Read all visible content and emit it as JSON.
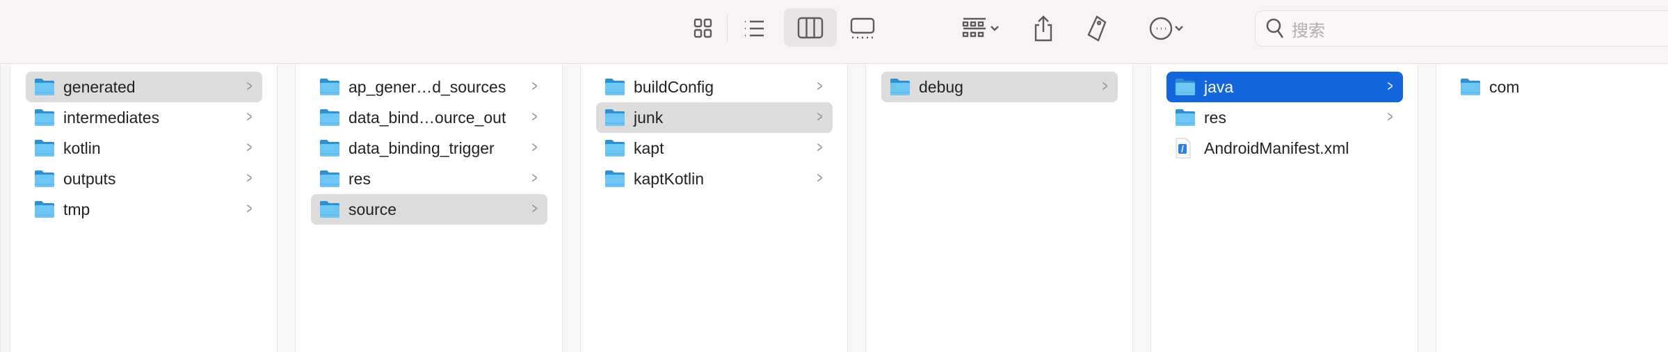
{
  "toolbar": {
    "view_buttons": [
      {
        "icon": "icon-view-icon"
      },
      {
        "icon": "list-view-icon"
      },
      {
        "icon": "column-view-icon",
        "selected": true
      },
      {
        "icon": "gallery-view-icon"
      }
    ],
    "group_icon": "group-icon",
    "share_icon": "share-icon",
    "tag_icon": "tag-icon",
    "more_icon": "more-icon",
    "search_placeholder": "搜索"
  },
  "colors": {
    "selection_active": "#1366de",
    "selection_inactive": "#dcdcdc",
    "folder": "#5ab8f0"
  },
  "columns": [
    {
      "items": [
        {
          "label": "generated",
          "type": "folder",
          "state": "highlighted"
        },
        {
          "label": "intermediates",
          "type": "folder"
        },
        {
          "label": "kotlin",
          "type": "folder"
        },
        {
          "label": "outputs",
          "type": "folder"
        },
        {
          "label": "tmp",
          "type": "folder"
        }
      ]
    },
    {
      "items": [
        {
          "label": "ap_gener…d_sources",
          "type": "folder"
        },
        {
          "label": "data_bind…ource_out",
          "type": "folder"
        },
        {
          "label": "data_binding_trigger",
          "type": "folder"
        },
        {
          "label": "res",
          "type": "folder"
        },
        {
          "label": "source",
          "type": "folder",
          "state": "highlighted"
        }
      ]
    },
    {
      "items": [
        {
          "label": "buildConfig",
          "type": "folder"
        },
        {
          "label": "junk",
          "type": "folder",
          "state": "highlighted"
        },
        {
          "label": "kapt",
          "type": "folder"
        },
        {
          "label": "kaptKotlin",
          "type": "folder"
        }
      ]
    },
    {
      "items": [
        {
          "label": "debug",
          "type": "folder",
          "state": "highlighted"
        }
      ]
    },
    {
      "items": [
        {
          "label": "java",
          "type": "folder",
          "state": "active"
        },
        {
          "label": "res",
          "type": "folder"
        },
        {
          "label": "AndroidManifest.xml",
          "type": "file"
        }
      ]
    },
    {
      "items": [
        {
          "label": "com",
          "type": "folder",
          "leaf": true
        }
      ]
    }
  ]
}
